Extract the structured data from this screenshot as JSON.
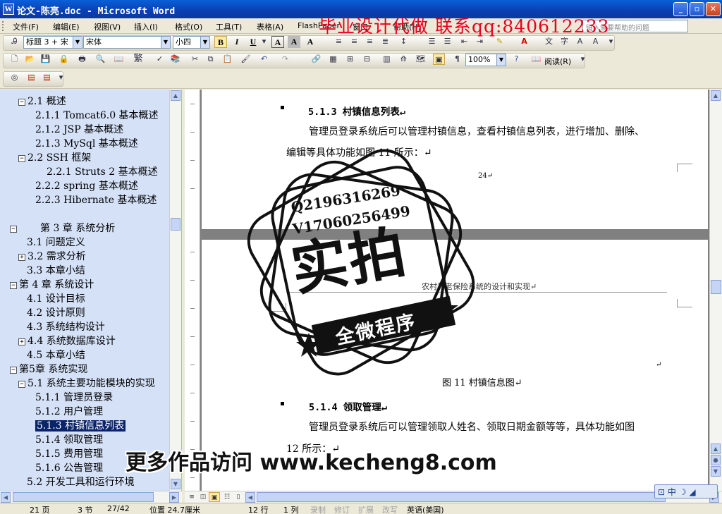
{
  "window": {
    "title": "论文-陈亮.doc - Microsoft Word",
    "app_icon_letter": "W",
    "controls": [
      "_",
      "▫",
      "✕"
    ]
  },
  "menu": {
    "items": [
      "文件(F)",
      "编辑(E)",
      "视图(V)",
      "插入(I)",
      "格式(O)",
      "工具(T)",
      "表格(A)",
      "FlashPaper",
      "窗口",
      "帮助(H)"
    ],
    "help_placeholder": "键入需要帮助的问题"
  },
  "overlay": {
    "promo_top": "毕业设计代做 联系qq:840612233",
    "stamp_qq": "Q2196316269",
    "stamp_v": "V17060256499",
    "stamp_big": "实拍",
    "stamp_ribbon": "全微程序",
    "promo_bottom": "更多作品访问 www.kecheng8.com"
  },
  "format_toolbar": {
    "style": "标题 3 + 宋",
    "font": "宋体",
    "size": "小四",
    "bold": "B",
    "italic": "I",
    "underline": "U",
    "char_border": "A",
    "char_shade": "A",
    "scale": "A"
  },
  "standard_toolbar": {
    "traditional": "繁",
    "zoom": "100%",
    "read": "阅读(R)"
  },
  "nav": {
    "items": [
      {
        "text": "2.1 概述",
        "exp": "⊟"
      },
      {
        "text": "2.1.1 Tomcat6.0 基本概述",
        "exp": ""
      },
      {
        "text": "2.1.2 JSP 基本概述",
        "exp": ""
      },
      {
        "text": "2.1.3 MySql 基本概述",
        "exp": ""
      },
      {
        "text": "2.2 SSH 框架",
        "exp": "⊟"
      },
      {
        "text": "2.2.1 Struts 2 基本概述",
        "exp": ""
      },
      {
        "text": "2.2.2 spring 基本概述",
        "exp": ""
      },
      {
        "text": "2.2.3 Hibernate 基本概述",
        "exp": ""
      },
      {
        "text": "第 3 章 系统分析",
        "exp": "⊟"
      },
      {
        "text": "3.1 问题定义",
        "exp": ""
      },
      {
        "text": "3.2 需求分析",
        "exp": "⊞"
      },
      {
        "text": "3.3 本章小结",
        "exp": ""
      },
      {
        "text": "第 4 章 系统设计",
        "exp": "⊟"
      },
      {
        "text": "4.1 设计目标",
        "exp": ""
      },
      {
        "text": "4.2 设计原则",
        "exp": ""
      },
      {
        "text": "4.3 系统结构设计",
        "exp": ""
      },
      {
        "text": "4.4 系统数据库设计",
        "exp": "⊞"
      },
      {
        "text": "4.5 本章小结",
        "exp": ""
      },
      {
        "text": "第5章 系统实现",
        "exp": "⊟"
      },
      {
        "text": "5.1 系统主要功能模块的实现",
        "exp": "⊟"
      },
      {
        "text": "5.1.1 管理员登录",
        "exp": ""
      },
      {
        "text": "5.1.2 用户管理",
        "exp": ""
      },
      {
        "text": "5.1.3 村镇信息列表",
        "exp": ""
      },
      {
        "text": "5.1.4 领取管理",
        "exp": ""
      },
      {
        "text": "5.1.5 费用管理",
        "exp": ""
      },
      {
        "text": "5.1.6 公告管理",
        "exp": ""
      },
      {
        "text": "5.2 开发工具和运行环境",
        "exp": ""
      }
    ]
  },
  "document": {
    "heading1": "5.1.3 村镇信息列表↵",
    "para1_line1": "管理员登录系统后可以管理村镇信息，查看村镇信息列表，进行增加、删除、",
    "para1_line2": "编辑等具体功能如图 11 所示：↵",
    "page_number": "24↵",
    "page_header": "农村养老保险系统的设计和实现↵",
    "figure_caption": "图 11 村镇信息图↵",
    "empty_mark": "↵",
    "heading2": "5.1.4 领取管理↵",
    "para2_line1": "管理员登录系统后可以管理领取人姓名、领取日期金额等等，具体功能如图",
    "para2_line2": "12 所示：↵"
  },
  "ime": {
    "label": "中",
    "icons": [
      "☽",
      "◢"
    ]
  },
  "status": {
    "page": "21 页",
    "section": "3 节",
    "pages": "27/42",
    "position": "位置 24.7厘米",
    "line": "12 行",
    "col": "1 列",
    "rec": "录制",
    "trk": "修订",
    "ext": "扩展",
    "ovr": "改写",
    "lang": "英语(美国)"
  }
}
